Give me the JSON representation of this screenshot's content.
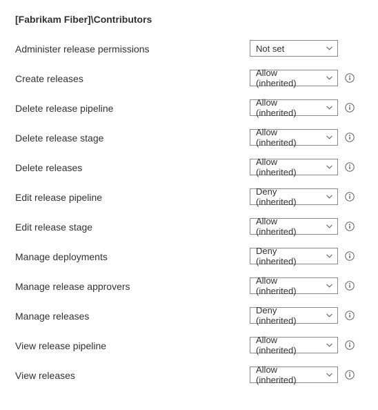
{
  "title": "[Fabrikam Fiber]\\Contributors",
  "permissions": [
    {
      "label": "Administer release permissions",
      "value": "Not set",
      "has_info": false
    },
    {
      "label": "Create releases",
      "value": "Allow (inherited)",
      "has_info": true
    },
    {
      "label": "Delete release pipeline",
      "value": "Allow (inherited)",
      "has_info": true
    },
    {
      "label": "Delete release stage",
      "value": "Allow (inherited)",
      "has_info": true
    },
    {
      "label": "Delete releases",
      "value": "Allow (inherited)",
      "has_info": true
    },
    {
      "label": "Edit release pipeline",
      "value": "Deny (inherited)",
      "has_info": true
    },
    {
      "label": "Edit release stage",
      "value": "Allow (inherited)",
      "has_info": true
    },
    {
      "label": "Manage deployments",
      "value": "Deny (inherited)",
      "has_info": true
    },
    {
      "label": "Manage release approvers",
      "value": "Allow (inherited)",
      "has_info": true
    },
    {
      "label": "Manage releases",
      "value": "Deny (inherited)",
      "has_info": true
    },
    {
      "label": "View release pipeline",
      "value": "Allow (inherited)",
      "has_info": true
    },
    {
      "label": "View releases",
      "value": "Allow (inherited)",
      "has_info": true
    }
  ]
}
